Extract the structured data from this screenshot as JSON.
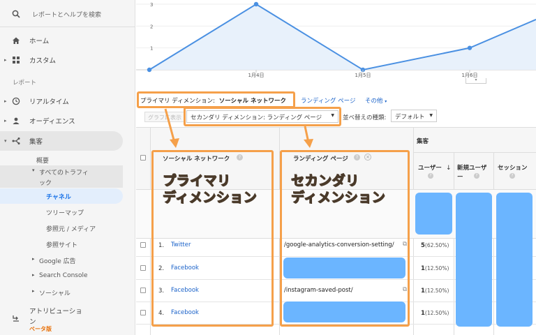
{
  "sidebar": {
    "search_label": "レポートとヘルプを検索",
    "home": "ホーム",
    "custom": "カスタム",
    "report_header": "レポート",
    "realtime": "リアルタイム",
    "audience": "オーディエンス",
    "acquisition": "集客",
    "overview": "概要",
    "all_traffic_line1": "すべてのトラフィ",
    "all_traffic_line2": "ック",
    "channels": "チャネル",
    "treemap": "ツリーマップ",
    "source_medium": "参照元 / メディア",
    "referrals": "参照サイト",
    "google_ads": "Google 広告",
    "search_console": "Search Console",
    "social": "ソーシャル",
    "attribution_line1": "アトリビューショ",
    "attribution_line2": "ン",
    "beta": "ベータ版"
  },
  "chart_data": {
    "type": "line",
    "x": [
      "",
      "1月4日",
      "1月5日",
      "1月6日",
      ""
    ],
    "values": [
      0,
      3,
      0,
      1,
      2.3
    ],
    "yticks": [
      "1",
      "2",
      "3"
    ],
    "ylim": [
      0,
      3
    ],
    "color": "#4a90e2"
  },
  "dimension_bar": {
    "primary_label": "プライマリ ディメンション:",
    "primary_value": "ソーシャル ネットワーク",
    "landing_page": "ランディング ページ",
    "other": "その他"
  },
  "toolbar": {
    "graph_btn": "グラフに表示",
    "secondary_dim": "セカンダリ ディメンション: ランディング ページ",
    "sort_label": "並べ替えの種類:",
    "sort_value": "デフォルト"
  },
  "table": {
    "acquisition_header": "集客",
    "col_social": "ソーシャル ネットワーク",
    "col_landing": "ランディング ページ",
    "col_users": "ユーザー",
    "col_new_users_line1": "新規ユーザ",
    "col_new_users_line2": "ー",
    "col_sessions": "セッション",
    "rows": [
      {
        "num": "1.",
        "network": "Twitter",
        "page": "/google-analytics-conversion-setting/",
        "users": "5",
        "pct": "(62.50%)"
      },
      {
        "num": "2.",
        "network": "Facebook",
        "page": "",
        "users": "1",
        "pct": "(12.50%)"
      },
      {
        "num": "3.",
        "network": "Facebook",
        "page": "/instagram-saved-post/",
        "users": "1",
        "pct": "(12.50%)"
      },
      {
        "num": "4.",
        "network": "Facebook",
        "page": "",
        "users": "1",
        "pct": "(12.50%)"
      }
    ]
  },
  "annotations": {
    "primary_line1": "プライマリ",
    "primary_line2": "ディメンション",
    "secondary_line1": "セカンダリ",
    "secondary_line2": "ディメンション"
  },
  "colors": {
    "accent_orange": "#f5a04a",
    "link_blue": "#1a62c9",
    "redact_blue": "#6bb5ff",
    "active_item": "#1a73e8"
  }
}
